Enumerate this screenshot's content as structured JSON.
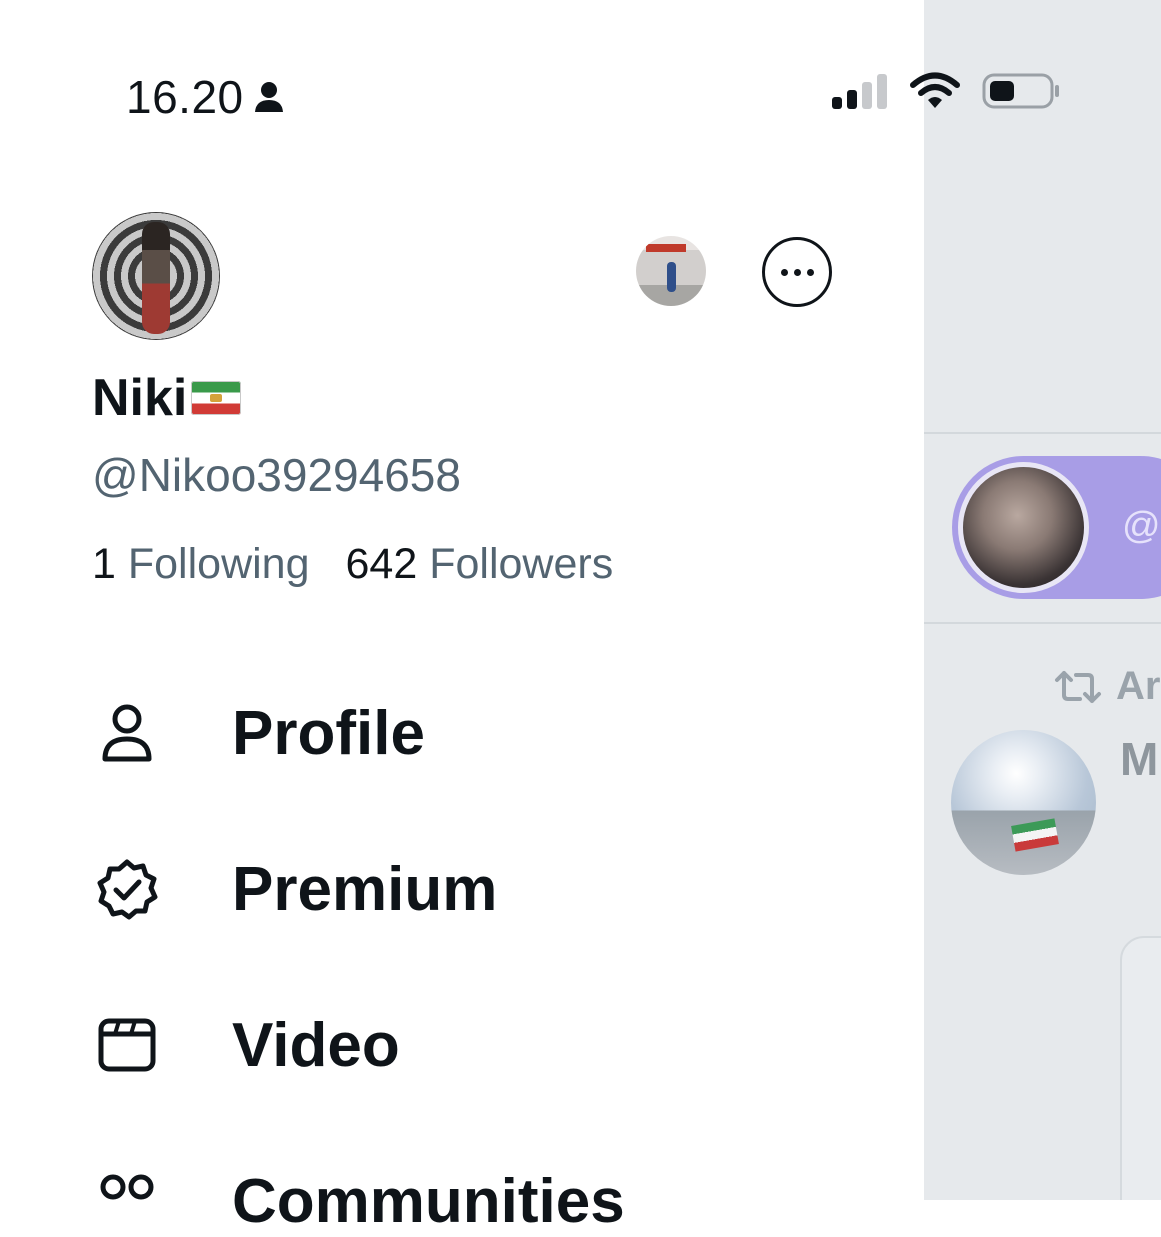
{
  "status_bar": {
    "time": "16.20",
    "icons": [
      "person-icon",
      "signal-icon",
      "wifi-icon",
      "battery-icon"
    ]
  },
  "profile": {
    "display_name": "Niki",
    "name_emoji": "iran-lion-and-sun-flag",
    "handle": "@Nikoo39294658",
    "following_count": "1",
    "following_label": "Following",
    "followers_count": "642",
    "followers_label": "Followers"
  },
  "menu": [
    {
      "label": "Profile",
      "icon": "person-icon"
    },
    {
      "label": "Premium",
      "icon": "verified-badge-icon"
    },
    {
      "label": "Video",
      "icon": "video-icon"
    },
    {
      "label": "Communities",
      "icon": "communities-icon"
    }
  ],
  "timeline": {
    "space_handle": "@",
    "retweet_text": "Ar",
    "tweet_author": "M"
  },
  "colors": {
    "text_primary": "#0f1419",
    "text_secondary": "#536471",
    "space_pill": "#a89de6",
    "dim_overlay": "#e6e9ec"
  }
}
